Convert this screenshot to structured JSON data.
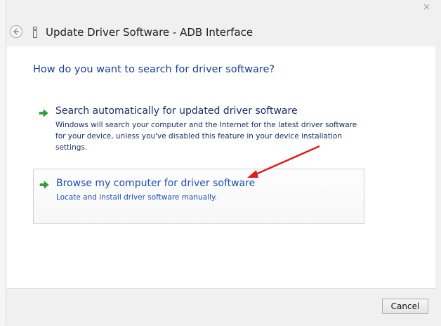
{
  "window": {
    "title": "Update Driver Software - ADB Interface",
    "close_glyph": "×"
  },
  "content": {
    "heading": "How do you want to search for driver software?",
    "options": [
      {
        "title": "Search automatically for updated driver software",
        "description": "Windows will search your computer and the Internet for the latest driver software for your device, unless you've disabled this feature in your device installation settings.",
        "icon": "green-arrow-icon"
      },
      {
        "title": "Browse my computer for driver software",
        "description": "Locate and install driver software manually.",
        "icon": "green-arrow-icon"
      }
    ]
  },
  "footer": {
    "cancel_label": "Cancel"
  },
  "colors": {
    "heading": "#1a3f8f",
    "option_text": "#1b2f66",
    "link_blue": "#1a4fb0",
    "arrow_green": "#2ea32e",
    "annotation_red": "#e01c1c"
  }
}
